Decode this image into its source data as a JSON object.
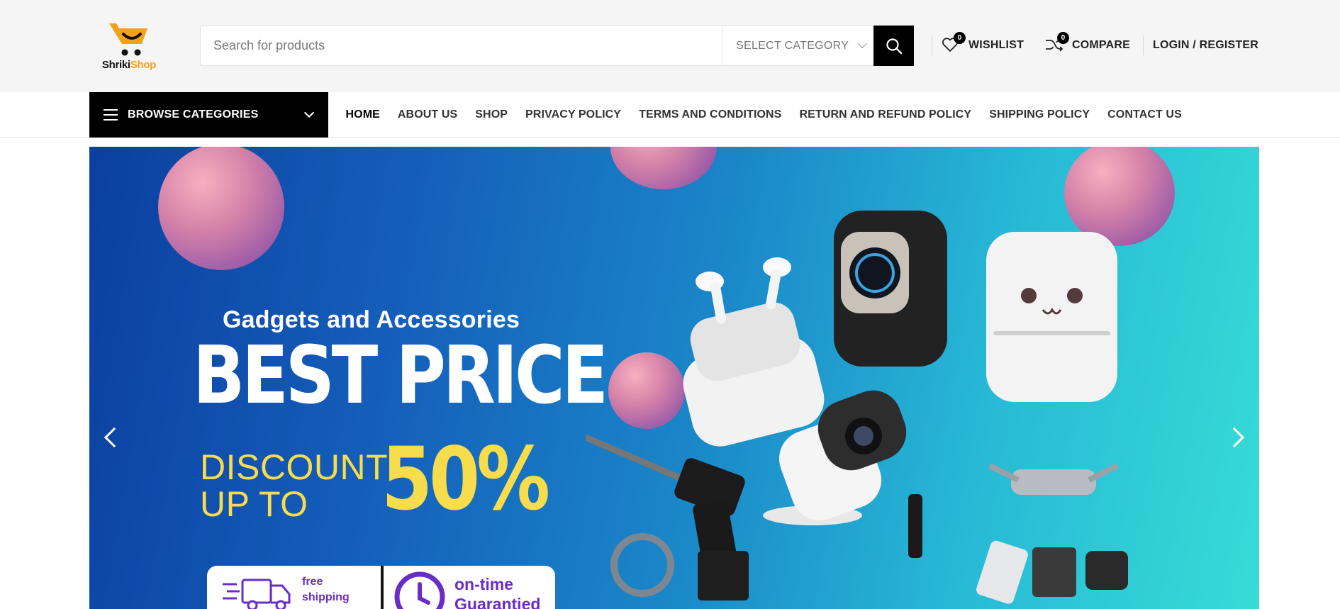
{
  "logo": {
    "part1": "Shriki",
    "part2": "Shop",
    "accent": "#f3a01b"
  },
  "search": {
    "placeholder": "Search for products",
    "category_label": "SELECT CATEGORY",
    "button_icon": "search-icon"
  },
  "header_links": {
    "wishlist": {
      "label": "WISHLIST",
      "count": "0",
      "icon": "heart-icon"
    },
    "compare": {
      "label": "COMPARE",
      "count": "0",
      "icon": "shuffle-icon"
    },
    "account": {
      "label": "LOGIN / REGISTER"
    }
  },
  "nav": {
    "browse_label": "BROWSE CATEGORIES",
    "items": [
      {
        "label": "HOME",
        "active": true
      },
      {
        "label": "ABOUT US"
      },
      {
        "label": "SHOP"
      },
      {
        "label": "PRIVACY POLICY"
      },
      {
        "label": "TERMS AND CONDITIONS"
      },
      {
        "label": "RETURN AND REFUND POLICY"
      },
      {
        "label": "SHIPPING POLICY"
      },
      {
        "label": "CONTACT US"
      }
    ]
  },
  "hero": {
    "subtitle": "Gadgets and Accessories",
    "title": "BEST PRICE",
    "discount_line1": "DISCOUNT",
    "discount_line2": "UP TO",
    "discount_value": "50%",
    "badge1": "free shipping",
    "badge2": "on-time Guarantied",
    "colors": {
      "gradient_start": "#0b3fa0",
      "gradient_end": "#37dcd6",
      "highlight": "#f7dc4c",
      "badge_text": "#6a2cc6"
    }
  }
}
